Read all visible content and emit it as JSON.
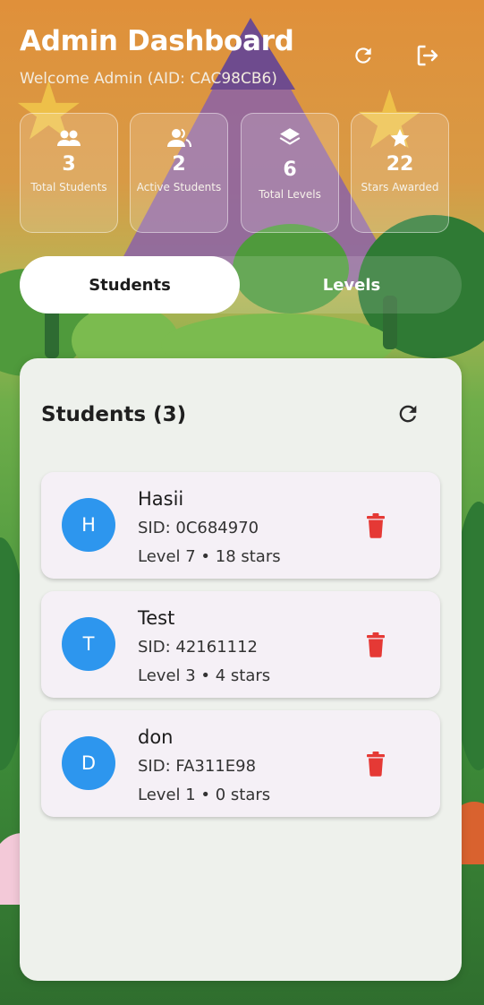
{
  "header": {
    "title": "Admin Dashboard",
    "subtitle": "Welcome Admin (AID: CAC98CB6)"
  },
  "stats": [
    {
      "icon": "users-icon",
      "value": "3",
      "label": "Total Students"
    },
    {
      "icon": "active-users-icon",
      "value": "2",
      "label": "Active Students"
    },
    {
      "icon": "layers-icon",
      "value": "6",
      "label": "Total Levels"
    },
    {
      "icon": "star-icon",
      "value": "22",
      "label": "Stars Awarded"
    }
  ],
  "tabs": {
    "students": "Students",
    "levels": "Levels",
    "active": "Students"
  },
  "panel": {
    "title": "Students (3)"
  },
  "students": [
    {
      "initial": "H",
      "name": "Hasii",
      "sid": "SID: 0C684970",
      "meta": "Level 7 • 18 stars"
    },
    {
      "initial": "T",
      "name": "Test",
      "sid": "SID: 42161112",
      "meta": "Level 3 • 4 stars"
    },
    {
      "initial": "D",
      "name": "don",
      "sid": "SID: FA311E98",
      "meta": "Level 1 • 0 stars"
    }
  ],
  "colors": {
    "avatar": "#2d96ee",
    "delete": "#e53935",
    "panel": "#eef1ec",
    "card": "#f5f0f6"
  }
}
